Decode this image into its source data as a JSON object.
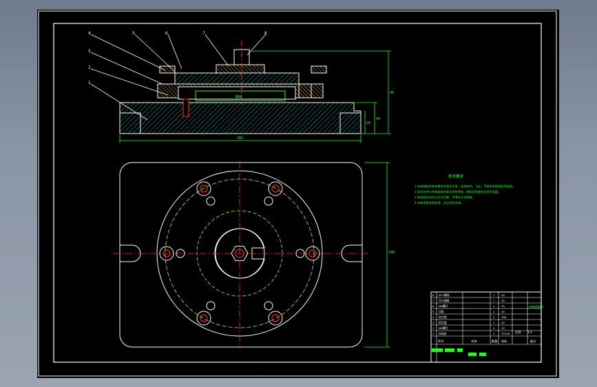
{
  "notes": {
    "title": "技术要求",
    "lines": [
      "1.夹具装配前所有零件须清洗干净，去除毛刺、飞边，不得有划痕碰伤等缺陷。",
      "2.定位元件与夹具体配合面须涂防锈油，装配后检查定位面平面度。",
      "3.夹紧机构动作应灵活可靠，不得有卡滞现象。",
      "4.夹具表面发黑处理，非工作面涂漆。"
    ]
  },
  "part_labels": [
    "4",
    "5",
    "6",
    "7",
    "8",
    "3",
    "2",
    "1"
  ],
  "title_block": {
    "parts_list": [
      {
        "no": "8",
        "name": "M12螺母",
        "qty": "1",
        "mat": "45"
      },
      {
        "no": "7",
        "name": "开口垫圈",
        "qty": "1",
        "mat": "45"
      },
      {
        "no": "6",
        "name": "M8螺钉",
        "qty": "4",
        "mat": "35"
      },
      {
        "no": "5",
        "name": "压板",
        "qty": "1",
        "mat": "45"
      },
      {
        "no": "4",
        "name": "定位销",
        "qty": "2",
        "mat": "T8A"
      },
      {
        "no": "3",
        "name": "定位盘",
        "qty": "1",
        "mat": "45"
      },
      {
        "no": "2",
        "name": "M8螺钉",
        "qty": "4",
        "mat": "35"
      },
      {
        "no": "1",
        "name": "夹具体",
        "qty": "1",
        "mat": "HT200"
      }
    ],
    "header": [
      "序号",
      "名称",
      "数量",
      "材料",
      "备注"
    ],
    "drawing_name": "夹具装配图",
    "scale_label": "比例",
    "scale": "1:1"
  },
  "dims": {
    "overall_width": "380",
    "overall_height": "96",
    "base_height": "40",
    "flange_height": "20",
    "plan_height": "280",
    "inner_dia": "Φ80"
  },
  "colors": {
    "frame": "#ffffff",
    "body_hatch": "#1fa7a0",
    "part_fill": "#d4a017",
    "centerline": "#ff3030",
    "dimension": "#22ff22",
    "circle_dashed": "#e6e600",
    "bolt": "#ff3333",
    "notes": "#22ff22"
  }
}
